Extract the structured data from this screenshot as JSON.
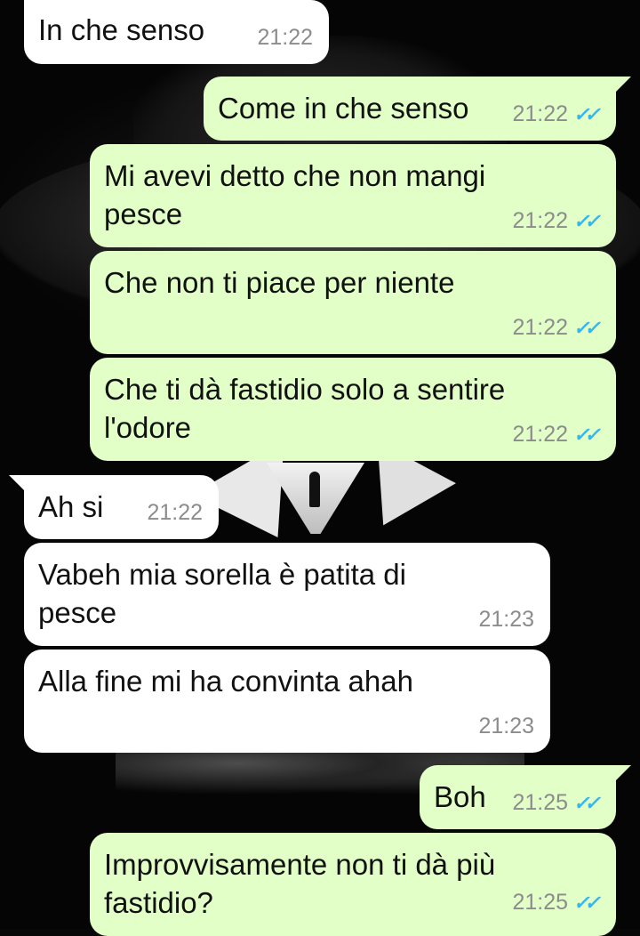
{
  "messages": [
    {
      "direction": "in",
      "text": "In che senso",
      "time": "21:22",
      "status": ""
    },
    {
      "direction": "out",
      "text": "Come in che senso",
      "time": "21:22",
      "status": "read"
    },
    {
      "direction": "out",
      "text": "Mi avevi detto che non mangi\npesce",
      "time": "21:22",
      "status": "read"
    },
    {
      "direction": "out",
      "text": "Che non ti piace per niente",
      "time": "21:22",
      "status": "read"
    },
    {
      "direction": "out",
      "text": "Che ti dà fastidio solo a sentire\nl'odore",
      "time": "21:22",
      "status": "read"
    },
    {
      "direction": "in",
      "text": "Ah si",
      "time": "21:22",
      "status": ""
    },
    {
      "direction": "in",
      "text": "Vabeh mia sorella è patita di\npesce",
      "time": "21:23",
      "status": ""
    },
    {
      "direction": "in",
      "text": "Alla fine mi ha convinta ahah",
      "time": "21:23",
      "status": ""
    },
    {
      "direction": "out",
      "text": "Boh",
      "time": "21:25",
      "status": "read"
    },
    {
      "direction": "out",
      "text": "Improvvisamente non ti dà più\nfastidio?",
      "time": "21:25",
      "status": "read"
    }
  ],
  "read_tick_glyph": "✓✓",
  "colors": {
    "incoming_bubble": "#ffffff",
    "outgoing_bubble": "#e2ffc8",
    "read_ticks": "#34b7f1",
    "timestamp": "#8c8c8c"
  },
  "wallpaper": "dark figure with hat"
}
